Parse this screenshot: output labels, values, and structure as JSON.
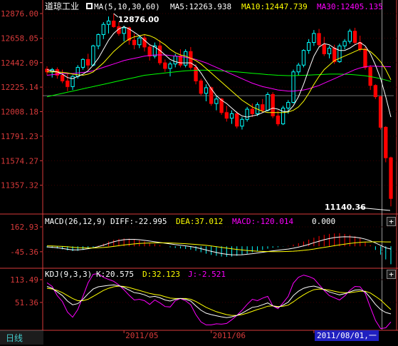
{
  "stock_name": "道琼工业",
  "period_tab": "日线",
  "cursor_date": "2011/08/01,一",
  "colors": {
    "up": "#00ffff",
    "down": "#ff0000",
    "ma5": "#ffffff",
    "ma10": "#ffff00",
    "ma30": "#ff00ff",
    "ma60": "#00ff00",
    "axis": "#d83a3a"
  },
  "main_panel": {
    "ma_label": "MA(5,10,30,60)",
    "ma5_label": "MA5:12263.938",
    "ma10_label": "MA10:12447.739",
    "ma30_label": "MA30:12405.135",
    "high_label": "12876.00",
    "low_label": "11140.36",
    "y_ticks": [
      "12876.00",
      "12658.05",
      "12442.09",
      "12225.14",
      "12008.18",
      "11791.23",
      "11574.27",
      "11357.32"
    ]
  },
  "macd_panel": {
    "title": "MACD(26,12,9)",
    "diff_label": "DIFF:-22.995",
    "dea_label": "DEA:37.012",
    "macd_label": "MACD:-120.014",
    "zero_label": "0.000",
    "y_ticks": [
      "162.93",
      "-45.36"
    ]
  },
  "kdj_panel": {
    "title": "KDJ(9,3,3)",
    "k_label": "K:20.575",
    "d_label": "D:32.123",
    "j_label": "J:-2.521",
    "y_ticks": [
      "113.49",
      "51.36"
    ]
  },
  "x_axis_labels": [
    "2011/05",
    "2011/06",
    "2011/"
  ],
  "chart_data": {
    "type": "candlestick",
    "ylim": [
      11140.36,
      12876.0
    ],
    "candles": [
      {
        "o": 12385,
        "h": 12410,
        "l": 12330,
        "c": 12360
      },
      {
        "o": 12360,
        "h": 12395,
        "l": 12310,
        "c": 12380
      },
      {
        "o": 12380,
        "h": 12400,
        "l": 12300,
        "c": 12330
      },
      {
        "o": 12330,
        "h": 12380,
        "l": 12260,
        "c": 12280
      },
      {
        "o": 12280,
        "h": 12340,
        "l": 12190,
        "c": 12230
      },
      {
        "o": 12230,
        "h": 12330,
        "l": 12200,
        "c": 12320
      },
      {
        "o": 12320,
        "h": 12420,
        "l": 12300,
        "c": 12400
      },
      {
        "o": 12400,
        "h": 12480,
        "l": 12380,
        "c": 12470
      },
      {
        "o": 12470,
        "h": 12520,
        "l": 12380,
        "c": 12420
      },
      {
        "o": 12420,
        "h": 12600,
        "l": 12410,
        "c": 12590
      },
      {
        "o": 12590,
        "h": 12700,
        "l": 12560,
        "c": 12690
      },
      {
        "o": 12690,
        "h": 12800,
        "l": 12650,
        "c": 12780
      },
      {
        "o": 12780,
        "h": 12850,
        "l": 12700,
        "c": 12810
      },
      {
        "o": 12810,
        "h": 12876,
        "l": 12750,
        "c": 12760
      },
      {
        "o": 12760,
        "h": 12800,
        "l": 12680,
        "c": 12700
      },
      {
        "o": 12700,
        "h": 12770,
        "l": 12630,
        "c": 12750
      },
      {
        "o": 12750,
        "h": 12760,
        "l": 12600,
        "c": 12640
      },
      {
        "o": 12640,
        "h": 12700,
        "l": 12560,
        "c": 12600
      },
      {
        "o": 12600,
        "h": 12680,
        "l": 12570,
        "c": 12660
      },
      {
        "o": 12660,
        "h": 12690,
        "l": 12540,
        "c": 12580
      },
      {
        "o": 12580,
        "h": 12600,
        "l": 12460,
        "c": 12500
      },
      {
        "o": 12500,
        "h": 12620,
        "l": 12480,
        "c": 12590
      },
      {
        "o": 12590,
        "h": 12640,
        "l": 12420,
        "c": 12440
      },
      {
        "o": 12440,
        "h": 12470,
        "l": 12360,
        "c": 12390
      },
      {
        "o": 12390,
        "h": 12450,
        "l": 12320,
        "c": 12430
      },
      {
        "o": 12430,
        "h": 12520,
        "l": 12400,
        "c": 12500
      },
      {
        "o": 12500,
        "h": 12560,
        "l": 12400,
        "c": 12420
      },
      {
        "o": 12420,
        "h": 12560,
        "l": 12400,
        "c": 12540
      },
      {
        "o": 12540,
        "h": 12580,
        "l": 12380,
        "c": 12400
      },
      {
        "o": 12400,
        "h": 12430,
        "l": 12250,
        "c": 12280
      },
      {
        "o": 12280,
        "h": 12300,
        "l": 12150,
        "c": 12170
      },
      {
        "o": 12170,
        "h": 12250,
        "l": 12100,
        "c": 12220
      },
      {
        "o": 12220,
        "h": 12230,
        "l": 12060,
        "c": 12080
      },
      {
        "o": 12080,
        "h": 12150,
        "l": 12020,
        "c": 12120
      },
      {
        "o": 12120,
        "h": 12130,
        "l": 11980,
        "c": 12000
      },
      {
        "o": 12000,
        "h": 12060,
        "l": 11920,
        "c": 11950
      },
      {
        "o": 11950,
        "h": 12020,
        "l": 11900,
        "c": 11990
      },
      {
        "o": 11990,
        "h": 12010,
        "l": 11860,
        "c": 11880
      },
      {
        "o": 11880,
        "h": 11960,
        "l": 11850,
        "c": 11940
      },
      {
        "o": 11940,
        "h": 12050,
        "l": 11920,
        "c": 12030
      },
      {
        "o": 12030,
        "h": 12080,
        "l": 11960,
        "c": 11990
      },
      {
        "o": 11990,
        "h": 12090,
        "l": 11970,
        "c": 12070
      },
      {
        "o": 12070,
        "h": 12120,
        "l": 12000,
        "c": 12020
      },
      {
        "o": 12020,
        "h": 12180,
        "l": 12010,
        "c": 12160
      },
      {
        "o": 12160,
        "h": 12180,
        "l": 11950,
        "c": 11970
      },
      {
        "o": 11970,
        "h": 12020,
        "l": 11880,
        "c": 11900
      },
      {
        "o": 11900,
        "h": 12060,
        "l": 11890,
        "c": 12040
      },
      {
        "o": 12040,
        "h": 12110,
        "l": 11990,
        "c": 12090
      },
      {
        "o": 12090,
        "h": 12380,
        "l": 12080,
        "c": 12360
      },
      {
        "o": 12360,
        "h": 12440,
        "l": 12330,
        "c": 12420
      },
      {
        "o": 12420,
        "h": 12560,
        "l": 12400,
        "c": 12550
      },
      {
        "o": 12550,
        "h": 12650,
        "l": 12520,
        "c": 12620
      },
      {
        "o": 12620,
        "h": 12730,
        "l": 12590,
        "c": 12700
      },
      {
        "o": 12700,
        "h": 12740,
        "l": 12580,
        "c": 12600
      },
      {
        "o": 12600,
        "h": 12670,
        "l": 12500,
        "c": 12520
      },
      {
        "o": 12520,
        "h": 12590,
        "l": 12480,
        "c": 12570
      },
      {
        "o": 12570,
        "h": 12600,
        "l": 12430,
        "c": 12450
      },
      {
        "o": 12450,
        "h": 12610,
        "l": 12440,
        "c": 12590
      },
      {
        "o": 12590,
        "h": 12650,
        "l": 12560,
        "c": 12630
      },
      {
        "o": 12630,
        "h": 12740,
        "l": 12610,
        "c": 12720
      },
      {
        "o": 12720,
        "h": 12750,
        "l": 12600,
        "c": 12620
      },
      {
        "o": 12620,
        "h": 12680,
        "l": 12540,
        "c": 12560
      },
      {
        "o": 12560,
        "h": 12580,
        "l": 12380,
        "c": 12400
      },
      {
        "o": 12400,
        "h": 12420,
        "l": 12200,
        "c": 12240
      },
      {
        "o": 12240,
        "h": 12250,
        "l": 12120,
        "c": 12140
      },
      {
        "o": 12140,
        "h": 12150,
        "l": 11850,
        "c": 11870
      },
      {
        "o": 11870,
        "h": 11880,
        "l": 11560,
        "c": 11600
      },
      {
        "o": 11600,
        "h": 11610,
        "l": 11170,
        "c": 11240
      }
    ],
    "ma5": [
      12380,
      12370,
      12360,
      12340,
      12310,
      12300,
      12320,
      12340,
      12370,
      12420,
      12480,
      12560,
      12640,
      12700,
      12740,
      12760,
      12740,
      12710,
      12680,
      12640,
      12600,
      12580,
      12550,
      12510,
      12470,
      12450,
      12440,
      12440,
      12440,
      12410,
      12350,
      12280,
      12210,
      12150,
      12110,
      12080,
      12040,
      12000,
      11970,
      11960,
      11970,
      11980,
      12000,
      12020,
      12040,
      12030,
      12010,
      12010,
      12060,
      12140,
      12250,
      12380,
      12500,
      12580,
      12610,
      12600,
      12570,
      12550,
      12550,
      12570,
      12600,
      12620,
      12590,
      12520,
      12420,
      12300,
      12140,
      11960
    ],
    "ma10": [
      12360,
      12360,
      12360,
      12355,
      12350,
      12340,
      12335,
      12330,
      12340,
      12360,
      12400,
      12440,
      12490,
      12540,
      12580,
      12620,
      12650,
      12670,
      12680,
      12690,
      12680,
      12660,
      12630,
      12600,
      12560,
      12530,
      12510,
      12500,
      12480,
      12460,
      12430,
      12390,
      12350,
      12310,
      12270,
      12230,
      12190,
      12150,
      12110,
      12080,
      12050,
      12030,
      12010,
      12000,
      12000,
      12000,
      12000,
      12005,
      12020,
      12050,
      12100,
      12170,
      12250,
      12320,
      12380,
      12420,
      12460,
      12480,
      12500,
      12520,
      12540,
      12560,
      12560,
      12540,
      12500,
      12450,
      12380,
      12290
    ],
    "ma30": [
      12330,
      12335,
      12340,
      12345,
      12345,
      12345,
      12350,
      12355,
      12360,
      12370,
      12385,
      12400,
      12415,
      12430,
      12445,
      12460,
      12470,
      12480,
      12490,
      12500,
      12505,
      12510,
      12510,
      12510,
      12505,
      12500,
      12495,
      12490,
      12480,
      12470,
      12455,
      12440,
      12420,
      12400,
      12380,
      12360,
      12340,
      12320,
      12300,
      12280,
      12260,
      12245,
      12230,
      12220,
      12210,
      12200,
      12195,
      12190,
      12190,
      12195,
      12200,
      12210,
      12225,
      12240,
      12260,
      12280,
      12300,
      12320,
      12340,
      12360,
      12380,
      12395,
      12405,
      12410,
      12410,
      12408,
      12407,
      12405
    ],
    "ma60": [
      12140,
      12150,
      12160,
      12170,
      12180,
      12190,
      12200,
      12210,
      12220,
      12230,
      12240,
      12250,
      12260,
      12270,
      12280,
      12290,
      12300,
      12310,
      12320,
      12330,
      12335,
      12340,
      12345,
      12350,
      12355,
      12360,
      12365,
      12370,
      12372,
      12374,
      12375,
      12375,
      12374,
      12372,
      12370,
      12367,
      12364,
      12360,
      12356,
      12352,
      12348,
      12344,
      12340,
      12336,
      12333,
      12330,
      12328,
      12327,
      12327,
      12328,
      12330,
      12332,
      12334,
      12336,
      12338,
      12340,
      12340,
      12340,
      12339,
      12337,
      12334,
      12330,
      12325,
      12318,
      12310,
      12300,
      12288,
      12275
    ],
    "macd_hist": [
      -10,
      -14,
      -18,
      -25,
      -34,
      -40,
      -38,
      -30,
      -20,
      -8,
      6,
      22,
      40,
      55,
      62,
      66,
      64,
      58,
      50,
      42,
      30,
      20,
      10,
      0,
      -8,
      -14,
      -18,
      -22,
      -28,
      -38,
      -50,
      -62,
      -72,
      -80,
      -86,
      -88,
      -86,
      -80,
      -72,
      -62,
      -50,
      -40,
      -30,
      -20,
      -12,
      -8,
      -2,
      4,
      14,
      26,
      40,
      56,
      72,
      86,
      96,
      104,
      108,
      110,
      104,
      96,
      84,
      66,
      40,
      10,
      -30,
      -70,
      -110,
      -150
    ],
    "macd_diff": [
      -5,
      -8,
      -12,
      -18,
      -25,
      -30,
      -30,
      -26,
      -20,
      -12,
      -2,
      10,
      24,
      38,
      48,
      55,
      58,
      58,
      55,
      50,
      44,
      38,
      32,
      26,
      20,
      14,
      9,
      4,
      -2,
      -10,
      -20,
      -31,
      -42,
      -52,
      -61,
      -67,
      -71,
      -72,
      -71,
      -67,
      -62,
      -56,
      -50,
      -44,
      -38,
      -33,
      -28,
      -23,
      -16,
      -7,
      4,
      16,
      30,
      43,
      55,
      65,
      73,
      78,
      80,
      79,
      76,
      70,
      60,
      46,
      28,
      8,
      -12,
      -23
    ],
    "macd_dea": [
      4,
      3,
      1,
      -1,
      -4,
      -8,
      -11,
      -13,
      -14,
      -14,
      -12,
      -10,
      -6,
      -1,
      5,
      11,
      16,
      20,
      24,
      26,
      28,
      29,
      29,
      29,
      28,
      26,
      24,
      22,
      19,
      16,
      12,
      8,
      3,
      -3,
      -9,
      -15,
      -21,
      -26,
      -31,
      -35,
      -38,
      -41,
      -43,
      -44,
      -45,
      -45,
      -44,
      -43,
      -41,
      -38,
      -34,
      -29,
      -23,
      -16,
      -9,
      -2,
      5,
      12,
      18,
      24,
      29,
      33,
      36,
      37,
      38,
      38,
      37,
      37
    ],
    "kdj_k": [
      95,
      90,
      80,
      70,
      55,
      45,
      48,
      60,
      75,
      88,
      94,
      96,
      98,
      99,
      97,
      92,
      85,
      78,
      76,
      72,
      66,
      68,
      64,
      58,
      55,
      60,
      62,
      60,
      55,
      42,
      30,
      22,
      18,
      15,
      12,
      10,
      12,
      16,
      22,
      30,
      38,
      40,
      45,
      50,
      42,
      38,
      44,
      52,
      70,
      82,
      90,
      94,
      96,
      92,
      86,
      80,
      76,
      72,
      75,
      80,
      85,
      86,
      80,
      64,
      46,
      32,
      24,
      20
    ],
    "kdj_d": [
      90,
      88,
      84,
      78,
      70,
      62,
      56,
      56,
      60,
      68,
      76,
      84,
      90,
      94,
      96,
      95,
      92,
      88,
      84,
      80,
      76,
      73,
      71,
      67,
      63,
      62,
      62,
      62,
      60,
      54,
      46,
      38,
      32,
      26,
      22,
      18,
      16,
      16,
      18,
      22,
      27,
      32,
      36,
      41,
      42,
      40,
      41,
      44,
      53,
      63,
      72,
      80,
      86,
      88,
      87,
      85,
      82,
      79,
      78,
      78,
      80,
      82,
      82,
      77,
      68,
      58,
      45,
      32
    ],
    "kdj_j": [
      105,
      95,
      70,
      54,
      25,
      11,
      32,
      68,
      105,
      128,
      130,
      120,
      114,
      109,
      99,
      86,
      71,
      58,
      60,
      56,
      46,
      58,
      50,
      40,
      39,
      56,
      62,
      56,
      45,
      18,
      -2,
      -10,
      -10,
      -7,
      -8,
      -6,
      4,
      16,
      30,
      46,
      60,
      56,
      63,
      68,
      42,
      34,
      50,
      68,
      104,
      120,
      126,
      122,
      116,
      100,
      84,
      70,
      64,
      58,
      69,
      84,
      95,
      94,
      76,
      38,
      2,
      -20,
      -18,
      -2
    ]
  }
}
